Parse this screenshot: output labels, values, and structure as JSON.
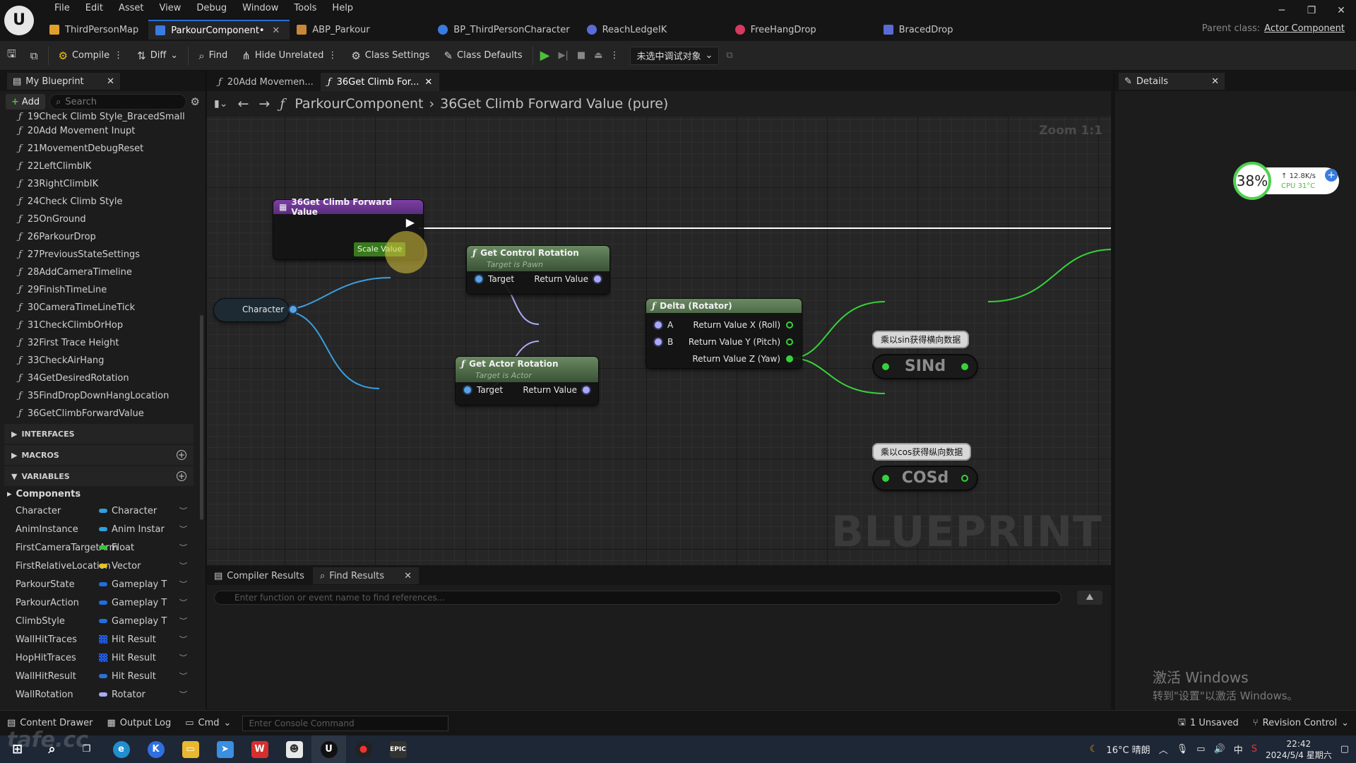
{
  "menu": [
    "File",
    "Edit",
    "Asset",
    "View",
    "Debug",
    "Window",
    "Tools",
    "Help"
  ],
  "asset_tabs": [
    {
      "label": "ThirdPersonMap",
      "color": "#e0a12b"
    },
    {
      "label": "ParkourComponent•",
      "color": "#3a7be0"
    },
    {
      "label": "ABP_Parkour",
      "color": "#c9873a"
    },
    {
      "label": "BP_ThirdPersonCharacter",
      "color": "#3a7be0"
    },
    {
      "label": "ReachLedgeIK",
      "color": "#5a6bd6"
    },
    {
      "label": "FreeHangDrop",
      "color": "#d63a5e"
    },
    {
      "label": "BracedDrop",
      "color": "#5a6bd6"
    }
  ],
  "parent_class": {
    "label": "Parent class:",
    "value": "Actor Component"
  },
  "toolbar": {
    "compile": "Compile",
    "diff": "Diff",
    "find": "Find",
    "hide_unrelated": "Hide Unrelated",
    "class_settings": "Class Settings",
    "class_defaults": "Class Defaults",
    "debug_select": "未选中调试对象"
  },
  "my_blueprint": {
    "tab": "My Blueprint",
    "add": "Add",
    "search_placeholder": "Search",
    "functions": [
      "19Check Climb Style_BracedSmall",
      "20Add Movement Inupt",
      "21MovementDebugReset",
      "22LeftClimbIK",
      "23RightClimbIK",
      "24Check Climb Style",
      "25OnGround",
      "26ParkourDrop",
      "27PreviousStateSettings",
      "28AddCameraTimeline",
      "29FinishTimeLine",
      "30CameraTimeLineTick",
      "31CheckClimbOrHop",
      "32First Trace Height",
      "33CheckAirHang",
      "34GetDesiredRotation",
      "35FindDropDownHangLocation",
      "36GetClimbForwardValue"
    ],
    "sections": {
      "interfaces": "INTERFACES",
      "macros": "MACROS",
      "variables": "VARIABLES",
      "components": "Components"
    },
    "variables": [
      {
        "name": "Character",
        "type": "Character",
        "color": "#2f9fe0"
      },
      {
        "name": "AnimInstance",
        "type": "Anim Instar",
        "color": "#2f9fe0"
      },
      {
        "name": "FirstCameraTargetArm",
        "type": "Float",
        "color": "#39c43a"
      },
      {
        "name": "FirstRelativeLocation",
        "type": "Vector",
        "color": "#e8c21c"
      },
      {
        "name": "ParkourState",
        "type": "Gameplay T",
        "color": "#1f6fe0"
      },
      {
        "name": "ParkourAction",
        "type": "Gameplay T",
        "color": "#1f6fe0"
      },
      {
        "name": "ClimbStyle",
        "type": "Gameplay T",
        "color": "#1f6fe0"
      },
      {
        "name": "WallHitTraces",
        "type": "Hit Result",
        "color": "#2a72d8",
        "grid": true
      },
      {
        "name": "HopHitTraces",
        "type": "Hit Result",
        "color": "#2a72d8",
        "grid": true
      },
      {
        "name": "WallHitResult",
        "type": "Hit Result",
        "color": "#2a72d8"
      },
      {
        "name": "WallRotation",
        "type": "Rotator",
        "color": "#a9a9f5"
      }
    ]
  },
  "graph_tabs": [
    "20Add Movemen...",
    "36Get Climb For..."
  ],
  "breadcrumb": {
    "root": "ParkourComponent",
    "current": "36Get Climb Forward Value (pure)"
  },
  "graph": {
    "zoom": "Zoom 1:1",
    "watermark": "BLUEPRINT",
    "entry_node": {
      "title": "36Get Climb Forward Value",
      "pin": "Scale Value"
    },
    "character_node": "Character",
    "get_control_rotation": {
      "title": "Get Control Rotation",
      "sub": "Target is Pawn",
      "in": "Target",
      "out": "Return Value"
    },
    "get_actor_rotation": {
      "title": "Get Actor Rotation",
      "sub": "Target is Actor",
      "in": "Target",
      "out": "Return Value"
    },
    "delta_rotator": {
      "title": "Delta (Rotator)",
      "a": "A",
      "b": "B",
      "x": "Return Value X (Roll)",
      "y": "Return Value Y (Pitch)",
      "z": "Return Value Z (Yaw)"
    },
    "comment_sin": "乘以sin获得横向数据",
    "comment_cos": "乘以cos获得纵向数据",
    "sind": "SINd",
    "cosd": "COSd"
  },
  "bottom_tabs": [
    "Compiler Results",
    "Find Results"
  ],
  "find_placeholder": "Enter function or event name to find references...",
  "details": {
    "tab": "Details",
    "activate_1": "激活 Windows",
    "activate_2": "转到\"设置\"以激活 Windows。",
    "net": {
      "percent": "38%",
      "speed": "12.8K/s",
      "cpu": "CPU 31°C"
    }
  },
  "statusbar": {
    "content_drawer": "Content Drawer",
    "output_log": "Output Log",
    "cmd": "Cmd",
    "console_placeholder": "Enter Console Command",
    "unsaved": "1 Unsaved",
    "revision": "Revision Control"
  },
  "taskbar": {
    "weather": "16°C 晴朗",
    "time": "22:42",
    "date": "2024/5/4 星期六",
    "ime": "中",
    "overlay": "tafe.cc"
  }
}
